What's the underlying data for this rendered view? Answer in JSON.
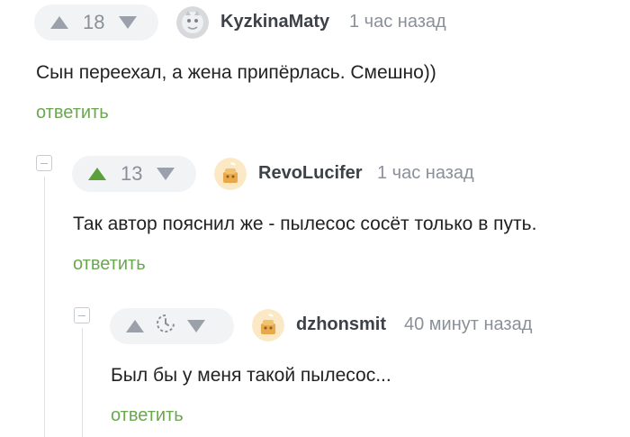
{
  "comments": [
    {
      "score": "18",
      "author": "KyzkinaMaty",
      "time": "1 час назад",
      "text": "Сын переехал, а жена припёрлась. Смешно))",
      "reply_label": "ответить"
    },
    {
      "score": "13",
      "author": "RevoLucifer",
      "time": "1 час назад",
      "text": "Так автор пояснил же - пылесос сосёт только в путь.",
      "reply_label": "ответить"
    },
    {
      "score": "",
      "score_icon": "timer-icon",
      "author": "dzhonsmit",
      "time": "40 минут назад",
      "text": "Был бы у меня такой пылесос...",
      "reply_label": "ответить"
    }
  ],
  "colors": {
    "accent_green": "#6aa84f",
    "upvote_green": "#5aa03c",
    "arrow_grey": "#9aa1aa"
  },
  "icons": [
    "upvote-icon",
    "downvote-icon",
    "timer-icon",
    "collapse-icon",
    "avatar"
  ]
}
